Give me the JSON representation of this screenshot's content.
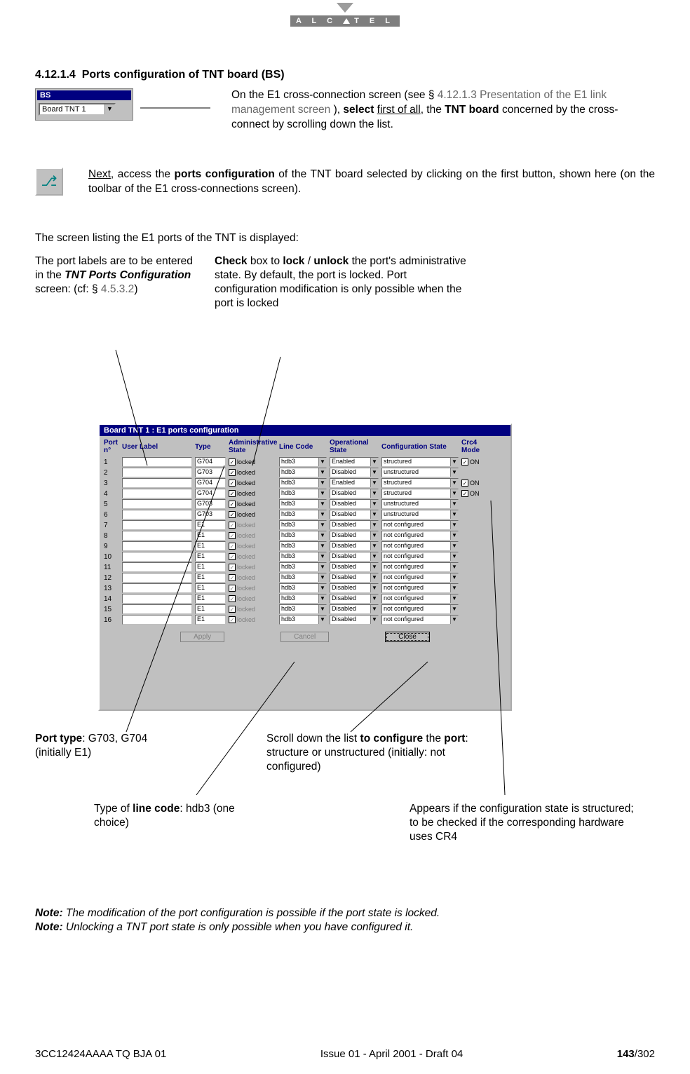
{
  "logo": {
    "text": "A L C ▲ T E L"
  },
  "section_number": "4.12.1.4",
  "section_title": "Ports configuration of TNT board (BS)",
  "bs_widget": {
    "title": "BS",
    "selected": "Board TNT  1"
  },
  "para1": {
    "pre": "On the E1 cross-connection screen (see § ",
    "link": "4.12.1.3 Presentation of the E1 link management screen",
    "mid": " ), ",
    "b1": "select",
    "u1": "first of all",
    "mid2": ", the ",
    "b2": "TNT board",
    "post": " concerned by the cross-connect by scrolling down the list."
  },
  "para2": {
    "u": "Next",
    "t1": ", access the ",
    "b": "ports configuration",
    "t2": " of the TNT board selected by clicking on the first button, shown here (on the toolbar of the E1 cross-connections screen)."
  },
  "para3": "The screen listing the E1 ports of the TNT is displayed:",
  "callout_label": {
    "l1": "The port labels are to be entered in the ",
    "i": "TNT Ports Configuration",
    "l2": " screen: (cf: § ",
    "link": "4.5.3.2",
    "l3": ")"
  },
  "callout_check": {
    "b1": "Check",
    "t1": " box to ",
    "b2": "lock",
    "t2": " / ",
    "b3": "unlock",
    "t3": " the port's administrative state. By default, the port is locked. Port configuration modification is only possible when the port is locked"
  },
  "screenshot": {
    "title": "Board TNT 1 : E1 ports configuration",
    "headers": {
      "port": "Port n°",
      "user": "User Label",
      "type": "Type",
      "adm": "Administrative State",
      "line": "Line Code",
      "op": "Operational State",
      "conf": "Configuration State",
      "crc": "Crc4 Mode"
    },
    "rows": [
      {
        "n": "1",
        "type": "G704",
        "admEnabled": true,
        "adm": "locked",
        "line": "hdb3",
        "op": "Enabled",
        "conf": "structured",
        "crc": "ON"
      },
      {
        "n": "2",
        "type": "G703",
        "admEnabled": true,
        "adm": "locked",
        "line": "hdb3",
        "op": "Disabled",
        "conf": "unstructured",
        "crc": ""
      },
      {
        "n": "3",
        "type": "G704",
        "admEnabled": true,
        "adm": "locked",
        "line": "hdb3",
        "op": "Enabled",
        "conf": "structured",
        "crc": "ON"
      },
      {
        "n": "4",
        "type": "G704",
        "admEnabled": true,
        "adm": "locked",
        "line": "hdb3",
        "op": "Disabled",
        "conf": "structured",
        "crc": "ON"
      },
      {
        "n": "5",
        "type": "G703",
        "admEnabled": true,
        "adm": "locked",
        "line": "hdb3",
        "op": "Disabled",
        "conf": "unstructured",
        "crc": ""
      },
      {
        "n": "6",
        "type": "G703",
        "admEnabled": true,
        "adm": "locked",
        "line": "hdb3",
        "op": "Disabled",
        "conf": "unstructured",
        "crc": ""
      },
      {
        "n": "7",
        "type": "E1",
        "admEnabled": false,
        "adm": "locked",
        "line": "hdb3",
        "op": "Disabled",
        "conf": "not configured",
        "crc": ""
      },
      {
        "n": "8",
        "type": "E1",
        "admEnabled": false,
        "adm": "locked",
        "line": "hdb3",
        "op": "Disabled",
        "conf": "not configured",
        "crc": ""
      },
      {
        "n": "9",
        "type": "E1",
        "admEnabled": false,
        "adm": "locked",
        "line": "hdb3",
        "op": "Disabled",
        "conf": "not configured",
        "crc": ""
      },
      {
        "n": "10",
        "type": "E1",
        "admEnabled": false,
        "adm": "locked",
        "line": "hdb3",
        "op": "Disabled",
        "conf": "not configured",
        "crc": ""
      },
      {
        "n": "11",
        "type": "E1",
        "admEnabled": false,
        "adm": "locked",
        "line": "hdb3",
        "op": "Disabled",
        "conf": "not configured",
        "crc": ""
      },
      {
        "n": "12",
        "type": "E1",
        "admEnabled": false,
        "adm": "locked",
        "line": "hdb3",
        "op": "Disabled",
        "conf": "not configured",
        "crc": ""
      },
      {
        "n": "13",
        "type": "E1",
        "admEnabled": false,
        "adm": "locked",
        "line": "hdb3",
        "op": "Disabled",
        "conf": "not configured",
        "crc": ""
      },
      {
        "n": "14",
        "type": "E1",
        "admEnabled": false,
        "adm": "locked",
        "line": "hdb3",
        "op": "Disabled",
        "conf": "not configured",
        "crc": ""
      },
      {
        "n": "15",
        "type": "E1",
        "admEnabled": false,
        "adm": "locked",
        "line": "hdb3",
        "op": "Disabled",
        "conf": "not configured",
        "crc": ""
      },
      {
        "n": "16",
        "type": "E1",
        "admEnabled": false,
        "adm": "locked",
        "line": "hdb3",
        "op": "Disabled",
        "conf": "not configured",
        "crc": ""
      }
    ],
    "buttons": {
      "apply": "Apply",
      "cancel": "Cancel",
      "close": "Close"
    }
  },
  "lc_porttype": {
    "b": "Port type",
    "t": ": G703, G704 (initially E1)"
  },
  "lc_linecode": {
    "t1": "Type of ",
    "b": "line code",
    "t2": ": hdb3 (one choice)"
  },
  "lc_scroll": {
    "t1": "Scroll down the list ",
    "b1": "to configure",
    "t2": " the ",
    "b2": "port",
    "t3": ": structure or unstructured (initially: not configured)"
  },
  "lc_crc": "Appears if the configuration state is structured; to be checked if the corresponding hardware uses CR4",
  "note1": {
    "b": "Note:",
    "t": "  The modification of the port configuration is possible if the port state is locked."
  },
  "note2": {
    "b": "Note:",
    "t": "  Unlocking a TNT port state is only possible when you have configured it."
  },
  "footer": {
    "left": "3CC12424AAAA TQ BJA 01",
    "center": "Issue 01 - April 2001 - Draft 04",
    "pagecur": "143",
    "pagetot": "/302"
  }
}
